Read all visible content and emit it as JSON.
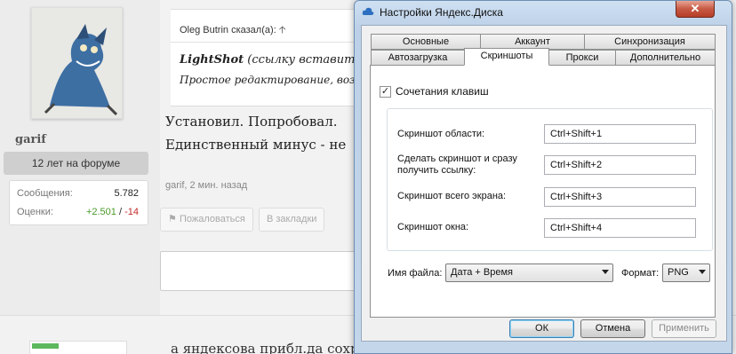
{
  "forum": {
    "user": {
      "name": "garif",
      "since": "12 лет на форуме",
      "stats": [
        {
          "label": "Сообщения:",
          "value": "5.782"
        },
        {
          "label": "Оценки:",
          "value_pos": "+2.501",
          "sep": "/",
          "value_neg": "-14"
        }
      ]
    },
    "quote": {
      "author": "Oleg Butrin сказал(а):",
      "title_bold": "LightShot",
      "title_rest": " (ссылку вставить н",
      "line2": "Простое редактирование, возм"
    },
    "post_text": [
      "Установил. Попробовал.",
      "Единственный минус - не"
    ],
    "meta": "garif, 2 мин. назад",
    "buttons": {
      "report": "Пожаловаться",
      "bookmark": "В закладки"
    },
    "bottom_text": "а яндексова прибл.да сохранности"
  },
  "dialog": {
    "title": "Настройки Яндекс.Диска",
    "close": "✕",
    "tabs_row1": [
      "Основные",
      "Аккаунт",
      "Синхронизация"
    ],
    "tabs_row2": [
      "Автозагрузка",
      "Скриншоты",
      "Прокси",
      "Дополнительно"
    ],
    "active_tab": "Скриншоты",
    "shortcuts_checkbox": {
      "label": "Сочетания клавиш",
      "checked": true,
      "mark": "✓"
    },
    "hotkeys": [
      {
        "label": "Скриншот области:",
        "value": "Ctrl+Shift+1"
      },
      {
        "label": "Сделать скриншот и сразу\nполучить ссылку:",
        "value": "Ctrl+Shift+2"
      },
      {
        "label": "Скриншот всего экрана:",
        "value": "Ctrl+Shift+3"
      },
      {
        "label": "Скриншот окна:",
        "value": "Ctrl+Shift+4"
      }
    ],
    "filename_label": "Имя файла:",
    "filename_value": "Дата + Время",
    "format_label": "Формат:",
    "format_value": "PNG",
    "ok": "ОК",
    "cancel": "Отмена",
    "apply": "Применить"
  }
}
